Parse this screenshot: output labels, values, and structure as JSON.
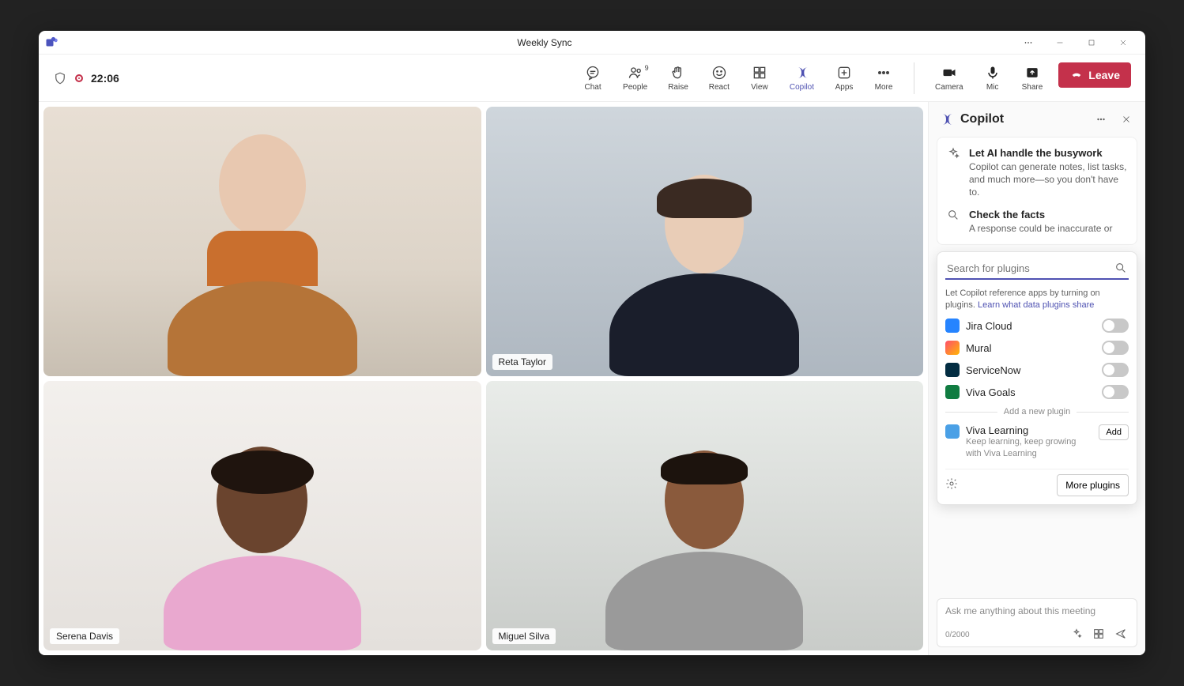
{
  "window": {
    "title": "Weekly Sync"
  },
  "toolbar": {
    "time": "22:06",
    "chat": "Chat",
    "people": "People",
    "people_count": "9",
    "raise": "Raise",
    "react": "React",
    "view": "View",
    "copilot": "Copilot",
    "apps": "Apps",
    "more": "More",
    "camera": "Camera",
    "mic": "Mic",
    "share": "Share",
    "leave": "Leave"
  },
  "participants": {
    "p2": "Reta Taylor",
    "p3": "Serena Davis",
    "p4": "Miguel Silva"
  },
  "copilot": {
    "title": "Copilot",
    "tip1_h": "Let AI handle the busywork",
    "tip1_d": "Copilot can generate notes, list tasks, and much more—so you don't have to.",
    "tip2_h": "Check the facts",
    "tip2_d": "A response could be inaccurate or",
    "search_placeholder": "Search for plugins",
    "hint_text": "Let Copilot reference apps by turning on plugins.  ",
    "hint_link": "Learn what data plugins share",
    "plugins": {
      "p1": "Jira Cloud",
      "p2": "Mural",
      "p3": "ServiceNow",
      "p4": "Viva Goals"
    },
    "divider": "Add a new plugin",
    "new_plugin_name": "Viva Learning",
    "new_plugin_desc": "Keep learning, keep growing with Viva Learning",
    "add": "Add",
    "more_plugins": "More plugins",
    "chat_placeholder": "Ask me anything about this meeting",
    "counter": "0/2000"
  }
}
